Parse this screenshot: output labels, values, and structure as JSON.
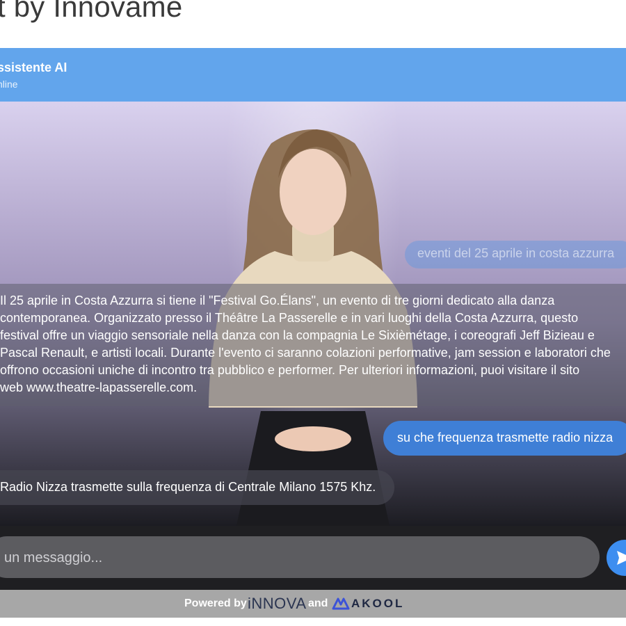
{
  "page": {
    "title": "t by Innovame"
  },
  "header": {
    "name": "ssistente AI",
    "status": "nline"
  },
  "messages": {
    "user1": "eventi del 25 aprile in costa azzurra",
    "bot1_lines": [
      "Il 25 aprile in Costa Azzurra si tiene il \"Festival Go.Élans\", un evento di tre giorni dedicato alla danza",
      "contemporanea. Organizzato presso il Théâtre La Passerelle e in vari luoghi della Costa Azzurra, questo",
      "festival offre un viaggio sensoriale nella danza con la compagnia Le Sixièmétage, i coreografi Jeff Bizieau e",
      "Pascal Renault, e artisti locali. Durante l'evento ci saranno colazioni performative, jam session e laboratori che",
      "offrono occasioni uniche di incontro tra pubblico e performer. Per ulteriori informazioni, puoi visitare il sito",
      "web www.theatre-lapasserelle.com."
    ],
    "user2": "su che frequenza trasmette radio nizza",
    "bot2": "Radio Nizza trasmette sulla frequenza di Centrale Milano 1575 Khz."
  },
  "input": {
    "placeholder": "un messaggio..."
  },
  "send": {
    "icon": "send-icon"
  },
  "footer": {
    "powered_by": "Powered by",
    "and": "and",
    "brand1": "iNNOVA",
    "brand2": "AKOOL"
  }
}
